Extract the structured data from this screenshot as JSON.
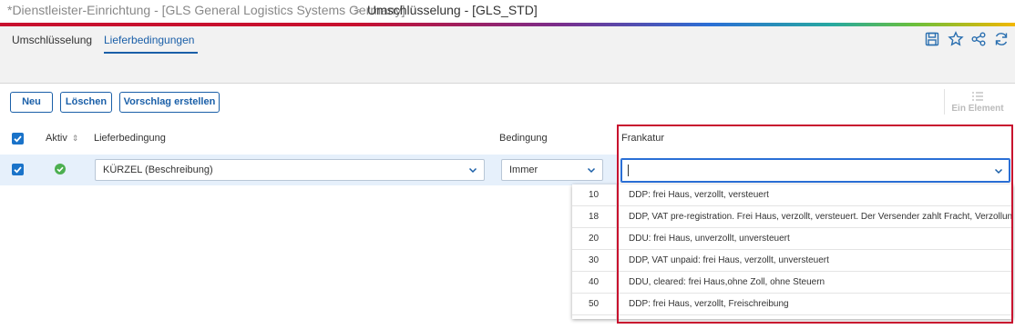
{
  "breadcrumb": {
    "parent": "*Dienstleister-Einrichtung - [GLS General Logistics Systems Germany]",
    "separator": ">",
    "current": "Umschlüsselung - [GLS_STD]"
  },
  "toolbar_icons": [
    "save-icon",
    "star-icon",
    "share-icon",
    "refresh-icon"
  ],
  "tabs": [
    {
      "label": "Umschlüsselung",
      "active": false
    },
    {
      "label": "Lieferbedingungen",
      "active": true
    }
  ],
  "actions": {
    "new_label": "Neu",
    "delete_label": "Löschen",
    "suggest_label": "Vorschlag erstellen",
    "single_element_label": "Ein Element"
  },
  "table": {
    "headers": {
      "active": "Aktiv",
      "delivery_condition": "Lieferbedingung",
      "condition": "Bedingung",
      "franking": "Frankatur"
    },
    "row": {
      "selected": true,
      "active": true,
      "delivery_condition_value": "KÜRZEL (Beschreibung)",
      "condition_value": "Immer",
      "franking_value": ""
    }
  },
  "franking_options": [
    {
      "code": "10",
      "label": "DDP: frei Haus, verzollt, versteuert"
    },
    {
      "code": "18",
      "label": "DDP, VAT pre-registration. Frei Haus, verzollt, versteuert. Der Versender zahlt Fracht, Verzollung"
    },
    {
      "code": "20",
      "label": "DDU: frei Haus, unverzollt, unversteuert"
    },
    {
      "code": "30",
      "label": "DDP, VAT unpaid: frei Haus, verzollt, unversteuert"
    },
    {
      "code": "40",
      "label": "DDU, cleared: frei Haus,ohne Zoll, ohne Steuern"
    },
    {
      "code": "50",
      "label": "DDP: frei Haus, verzollt, Freischreibung"
    }
  ],
  "colors": {
    "accent": "#1a5fa8",
    "highlight": "#c8102e",
    "ok": "#4caf50"
  }
}
